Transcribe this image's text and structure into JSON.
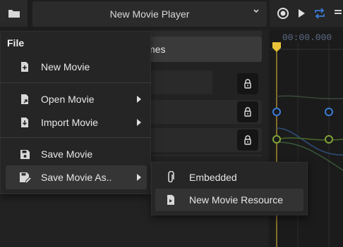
{
  "topbar": {
    "player_title": "New Movie Player"
  },
  "panel": {
    "frames_label": "Frames"
  },
  "timeline": {
    "time_display": "00:00.000"
  },
  "file_menu": {
    "header": "File",
    "items": [
      {
        "label": "New Movie",
        "icon": "new-file-icon"
      },
      {
        "label": "Open Movie",
        "icon": "open-file-icon",
        "submenu": true
      },
      {
        "label": "Import Movie",
        "icon": "import-file-icon",
        "submenu": true
      },
      {
        "label": "Save Movie",
        "icon": "save-icon"
      },
      {
        "label": "Save Movie As..",
        "icon": "save-as-icon",
        "submenu": true
      }
    ]
  },
  "save_as_submenu": {
    "items": [
      {
        "label": "Embedded",
        "icon": "paperclip-icon"
      },
      {
        "label": "New Movie Resource",
        "icon": "resource-file-icon"
      }
    ]
  },
  "colors": {
    "accent_blue": "#3a7bd5",
    "keyframe_yellow": "#e8c23a"
  }
}
